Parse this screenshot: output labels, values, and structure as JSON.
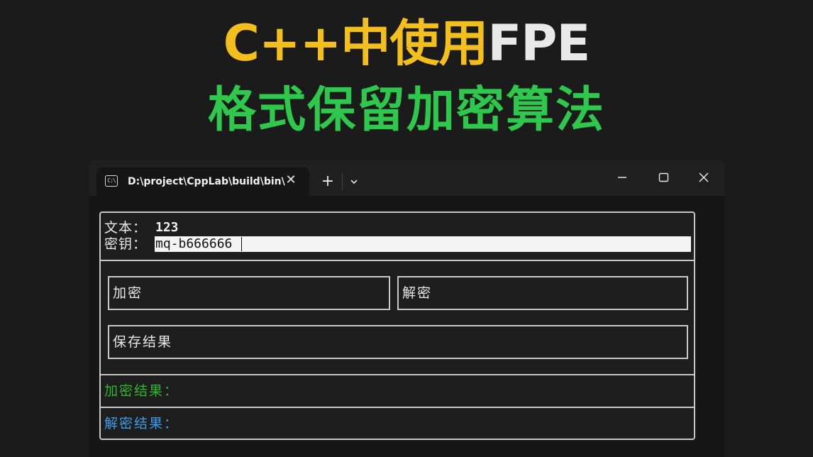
{
  "headline": {
    "line1_accent": "C++中使用",
    "line1_fpe": "FPE",
    "line2": "格式保留加密算法"
  },
  "window": {
    "tab_title": "D:\\project\\CppLab\\build\\bin\\",
    "tab_icon_glyph": "C:\\",
    "tab_icon_name": "console-icon",
    "tab_close_glyph": "✕",
    "new_tab_glyph": "+",
    "controls": [
      "minimize-icon",
      "maximize-icon",
      "close-icon"
    ]
  },
  "form": {
    "text_label": "文本：",
    "text_value": "123",
    "key_label": "密钥：",
    "key_value": "mq-b666666"
  },
  "buttons": {
    "encrypt": "加密",
    "decrypt": "解密",
    "save": "保存结果"
  },
  "results": {
    "encrypt_label": "加密结果：",
    "encrypt_value": "",
    "decrypt_label": "解密结果：",
    "decrypt_value": "",
    "encrypt_color": "#2fb52f",
    "decrypt_color": "#3d9be9"
  },
  "colors": {
    "headline_accent": "#f3bf1d",
    "headline_fpe": "#e9e9e9",
    "headline_line2": "#2ec94c"
  }
}
